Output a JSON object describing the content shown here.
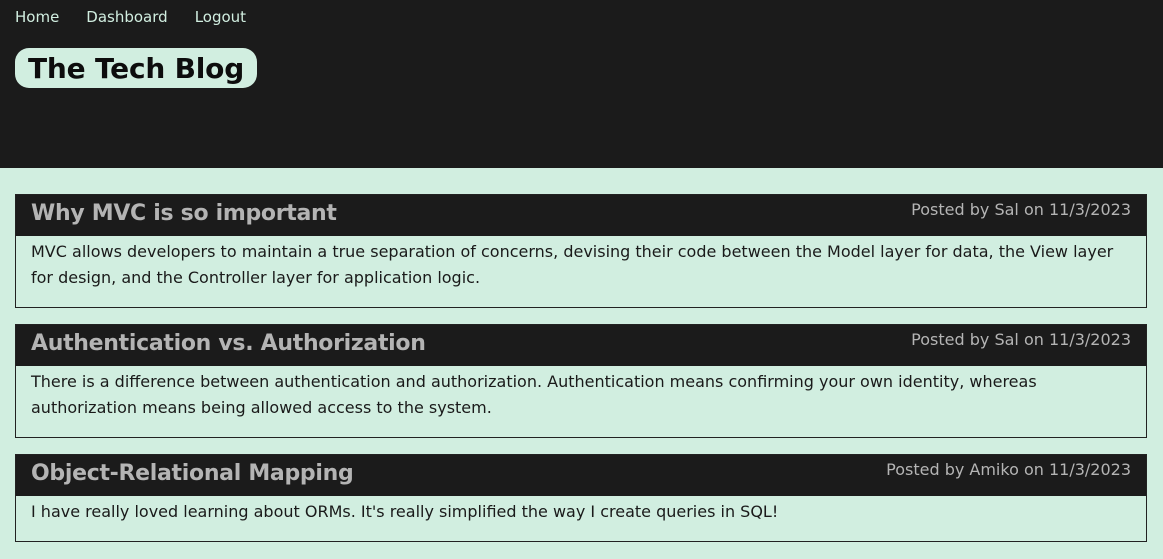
{
  "nav": {
    "home": "Home",
    "dashboard": "Dashboard",
    "logout": "Logout"
  },
  "header": {
    "title": "The Tech Blog"
  },
  "posts": [
    {
      "title": "Why MVC is so important",
      "meta": "Posted by Sal on 11/3/2023",
      "body": "MVC allows developers to maintain a true separation of concerns, devising their code between the Model layer for data, the View layer for design, and the Controller layer for application logic."
    },
    {
      "title": "Authentication vs. Authorization",
      "meta": "Posted by Sal on 11/3/2023",
      "body": "There is a difference between authentication and authorization. Authentication means confirming your own identity, whereas authorization means being allowed access to the system."
    },
    {
      "title": "Object-Relational Mapping",
      "meta": "Posted by Amiko on 11/3/2023",
      "body": "I have really loved learning about ORMs. It's really simplified the way I create queries in SQL!"
    }
  ],
  "colors": {
    "header_bg": "#1b1b1b",
    "page_bg": "#d1eee0",
    "nav_text": "#d1eee0",
    "post_title": "#b4b4b4"
  }
}
